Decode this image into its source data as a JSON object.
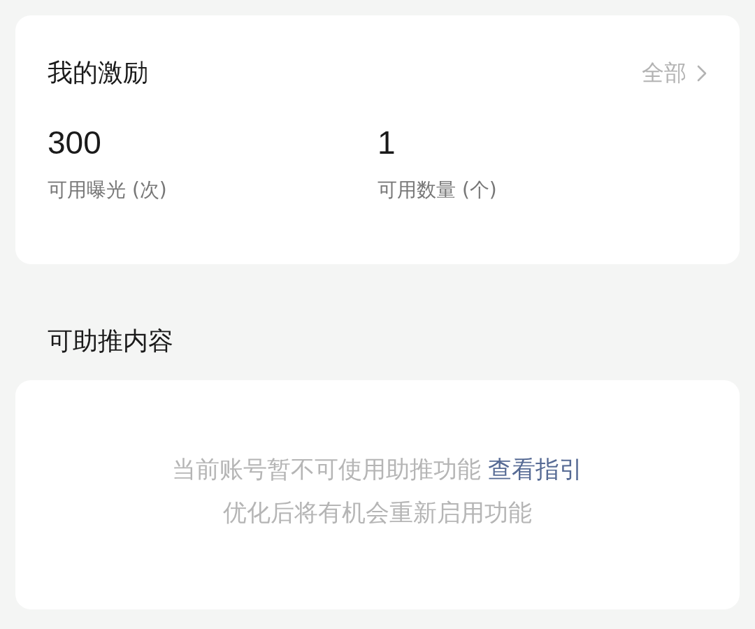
{
  "incentives": {
    "title": "我的激励",
    "all_link": "全部",
    "stats": [
      {
        "value": "300",
        "label": "可用曝光 (次)"
      },
      {
        "value": "1",
        "label": "可用数量 (个)"
      }
    ]
  },
  "boost": {
    "title": "可助推内容",
    "empty_message": "当前账号暂不可使用助推功能",
    "guide_link": "查看指引",
    "hint": "优化后将有机会重新启用功能"
  }
}
